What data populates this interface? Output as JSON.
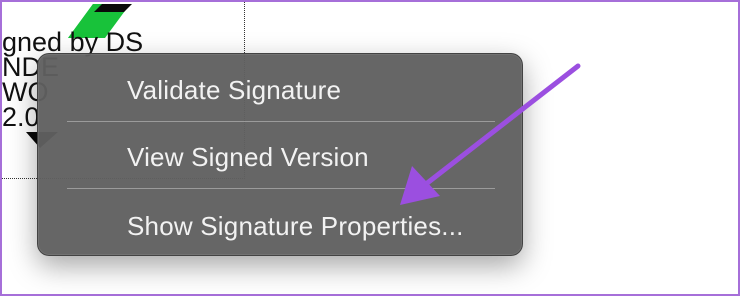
{
  "signature_field": {
    "lines": [
      "gned by DS",
      "NDE",
      "WO",
      "2.0"
    ]
  },
  "context_menu": {
    "items": [
      {
        "label": "Validate Signature"
      },
      {
        "label": "View Signed Version"
      },
      {
        "label": "Show Signature Properties..."
      }
    ]
  },
  "colors": {
    "frame_border": "#a66fd9",
    "menu_background": "#606060",
    "menu_text": "#f2f2f2",
    "annotation_arrow": "#9b4fe0",
    "signature_stripe": "#18c23a"
  }
}
